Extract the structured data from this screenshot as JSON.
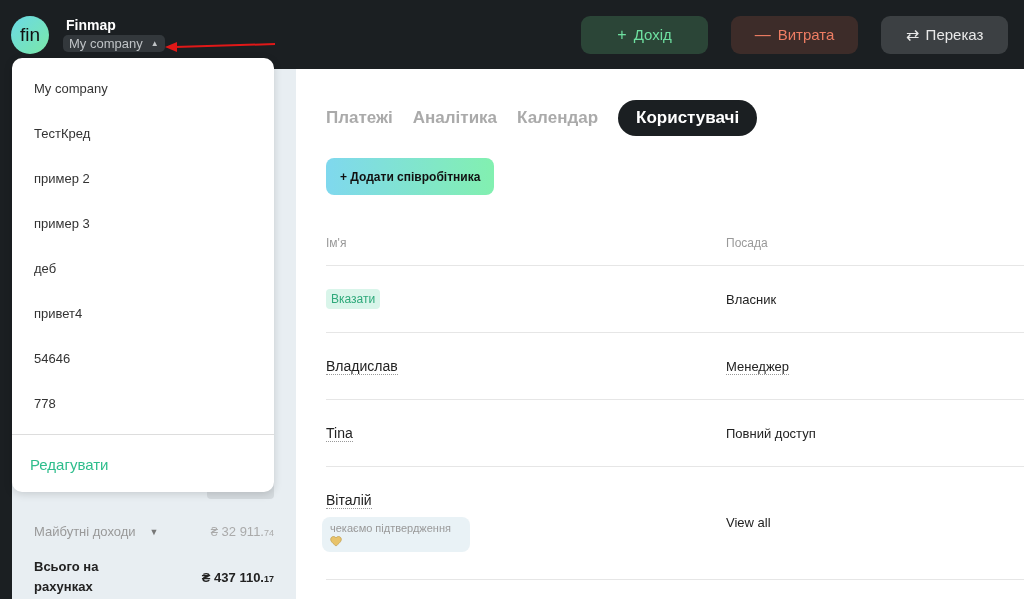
{
  "header": {
    "logo": "fin",
    "app_name": "Finmap",
    "company": "My company",
    "caret": "▲",
    "buttons": [
      {
        "kind": "income",
        "icon": "+",
        "label": "Дохід"
      },
      {
        "kind": "expense",
        "icon": "—",
        "label": "Витрата"
      },
      {
        "kind": "transfer",
        "icon": "⇄",
        "label": "Переказ"
      }
    ]
  },
  "company_menu": {
    "items": [
      {
        "label": "My company"
      },
      {
        "label": "ТестКред"
      },
      {
        "label": "пример 2"
      },
      {
        "label": "пример 3"
      },
      {
        "label": "деб"
      },
      {
        "label": "привет4"
      },
      {
        "label": "54646"
      },
      {
        "label": "778"
      }
    ],
    "action": "Редагувати"
  },
  "sidebar": {
    "future_income": {
      "label": "Майбутні доходи",
      "caret": "▼",
      "amount": "₴ 32 911.",
      "cents": "74"
    },
    "total": {
      "label": "Всього на рахунках",
      "amount": "₴ 437 110.",
      "cents": "17"
    }
  },
  "tabs": [
    {
      "label": "Платежі",
      "selected": false
    },
    {
      "label": "Аналітика",
      "selected": false
    },
    {
      "label": "Календар",
      "selected": false
    },
    {
      "label": "Користувачі",
      "selected": true
    }
  ],
  "add_button": "+ Додати співробітника",
  "table": {
    "columns": [
      "Ім'я",
      "Посада"
    ],
    "rows": [
      {
        "name": {
          "kind": "tag",
          "text": "Вказати"
        },
        "role": {
          "text": "Власник",
          "dotted": false
        }
      },
      {
        "name": {
          "kind": "text",
          "text": "Владислав"
        },
        "role": {
          "text": "Менеджер",
          "dotted": true
        }
      },
      {
        "name": {
          "kind": "text",
          "text": "Tina"
        },
        "role": {
          "text": "Повний доступ",
          "dotted": false
        }
      },
      {
        "name": {
          "kind": "text",
          "text": "Віталій",
          "status": "чекаємо підтвердження"
        },
        "role": {
          "text": "View all",
          "dotted": false
        }
      }
    ]
  }
}
